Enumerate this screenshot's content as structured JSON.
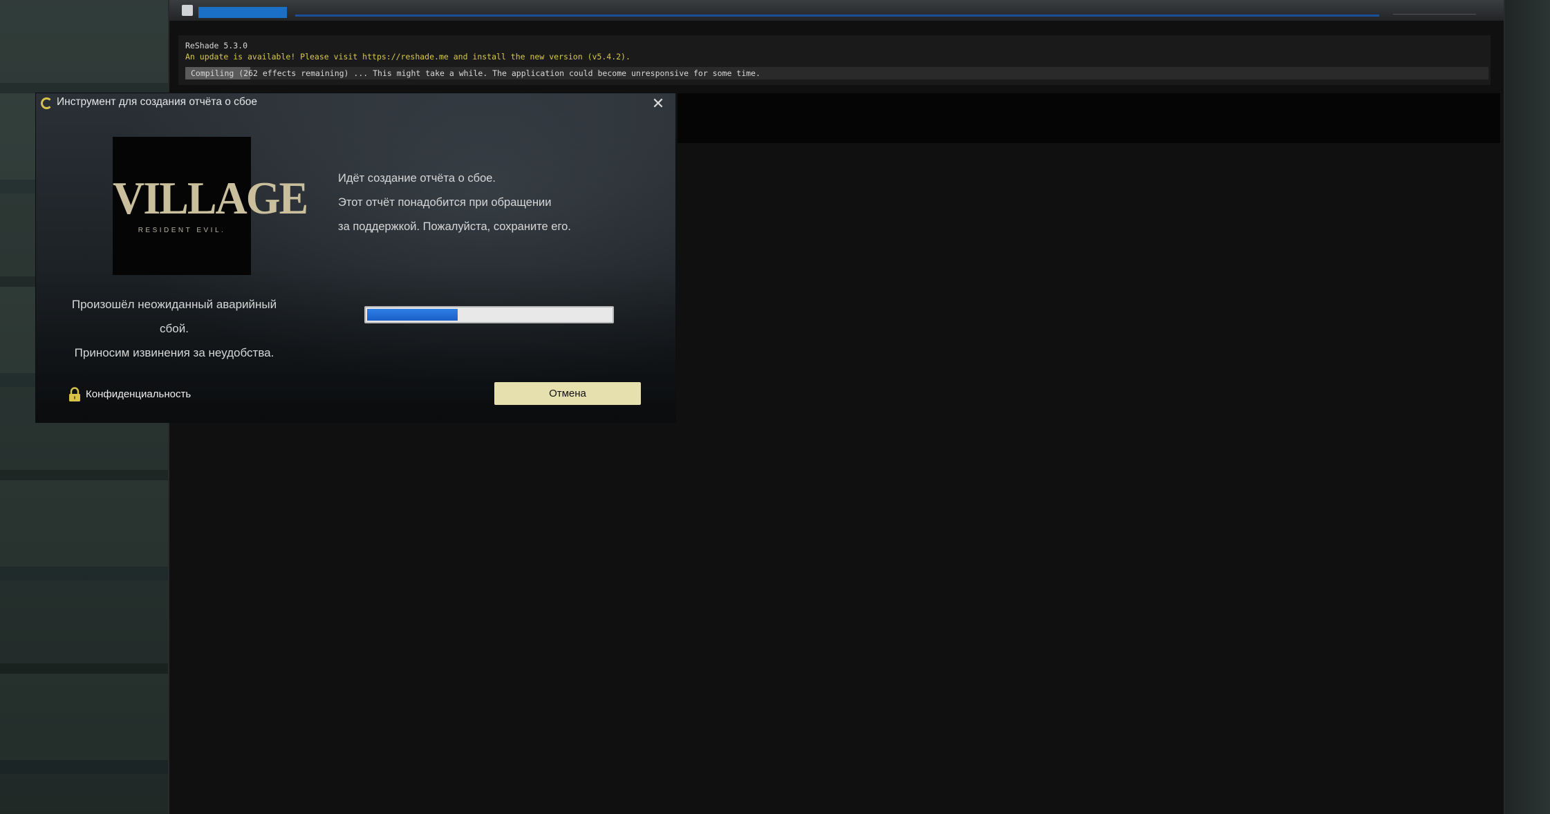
{
  "game_window": {
    "reshade": {
      "version": "ReShade 5.3.0",
      "update_notice": "An update is available! Please visit https://reshade.me and install the new version (v5.4.2).",
      "compile_status": "Compiling (262 effects remaining) ... This might take a while. The application could become unresponsive for some time.",
      "compile_progress": 0.05
    }
  },
  "dialog": {
    "title": "Инструмент для создания отчёта о сбое",
    "logo": {
      "main": "VILLAGE",
      "sub": "RESIDENT EVIL."
    },
    "left_message": {
      "line1": "Произошёл неожиданный аварийный",
      "line2": "сбой.",
      "line3": "Приносим извинения за неудобства."
    },
    "right_message": {
      "line1": "Идёт создание отчёта о сбое.",
      "line2": "Этот отчёт понадобится при обращении",
      "line3": "за поддержкой. Пожалуйста, сохраните его."
    },
    "progress": 0.37,
    "privacy_label": "Конфиденциальность",
    "cancel_label": "Отмена",
    "colors": {
      "accent_button": "#e6dfae",
      "progress_fill": "#1a6fd6",
      "app_icon": "#d9c24a"
    }
  }
}
